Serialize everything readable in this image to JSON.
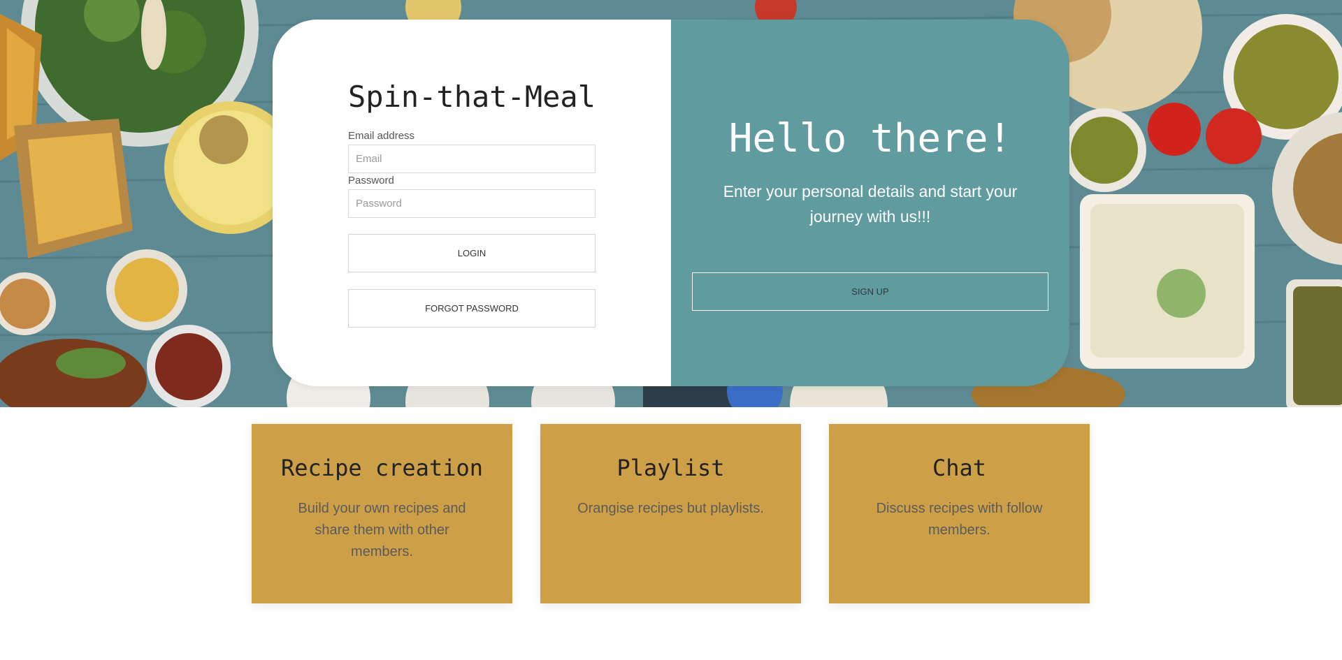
{
  "login": {
    "app_title": "Spin-that-Meal",
    "email_label": "Email address",
    "email_placeholder": "Email",
    "password_label": "Password",
    "password_placeholder": "Password",
    "login_label": "LOGIN",
    "forgot_label": "FORGOT PASSWORD"
  },
  "signup": {
    "title": "Hello there!",
    "subtitle": "Enter your personal details and start your journey with us!!!",
    "button_label": "SIGN UP"
  },
  "features": [
    {
      "title": "Recipe creation",
      "description": "Build your own recipes and share them with other members."
    },
    {
      "title": "Playlist",
      "description": "Orangise recipes but playlists."
    },
    {
      "title": "Chat",
      "description": "Discuss recipes with follow members."
    }
  ],
  "colors": {
    "signup_panel": "#5f9b9f",
    "feature_card": "#cd9f47",
    "table_background": "#5f8f97"
  }
}
